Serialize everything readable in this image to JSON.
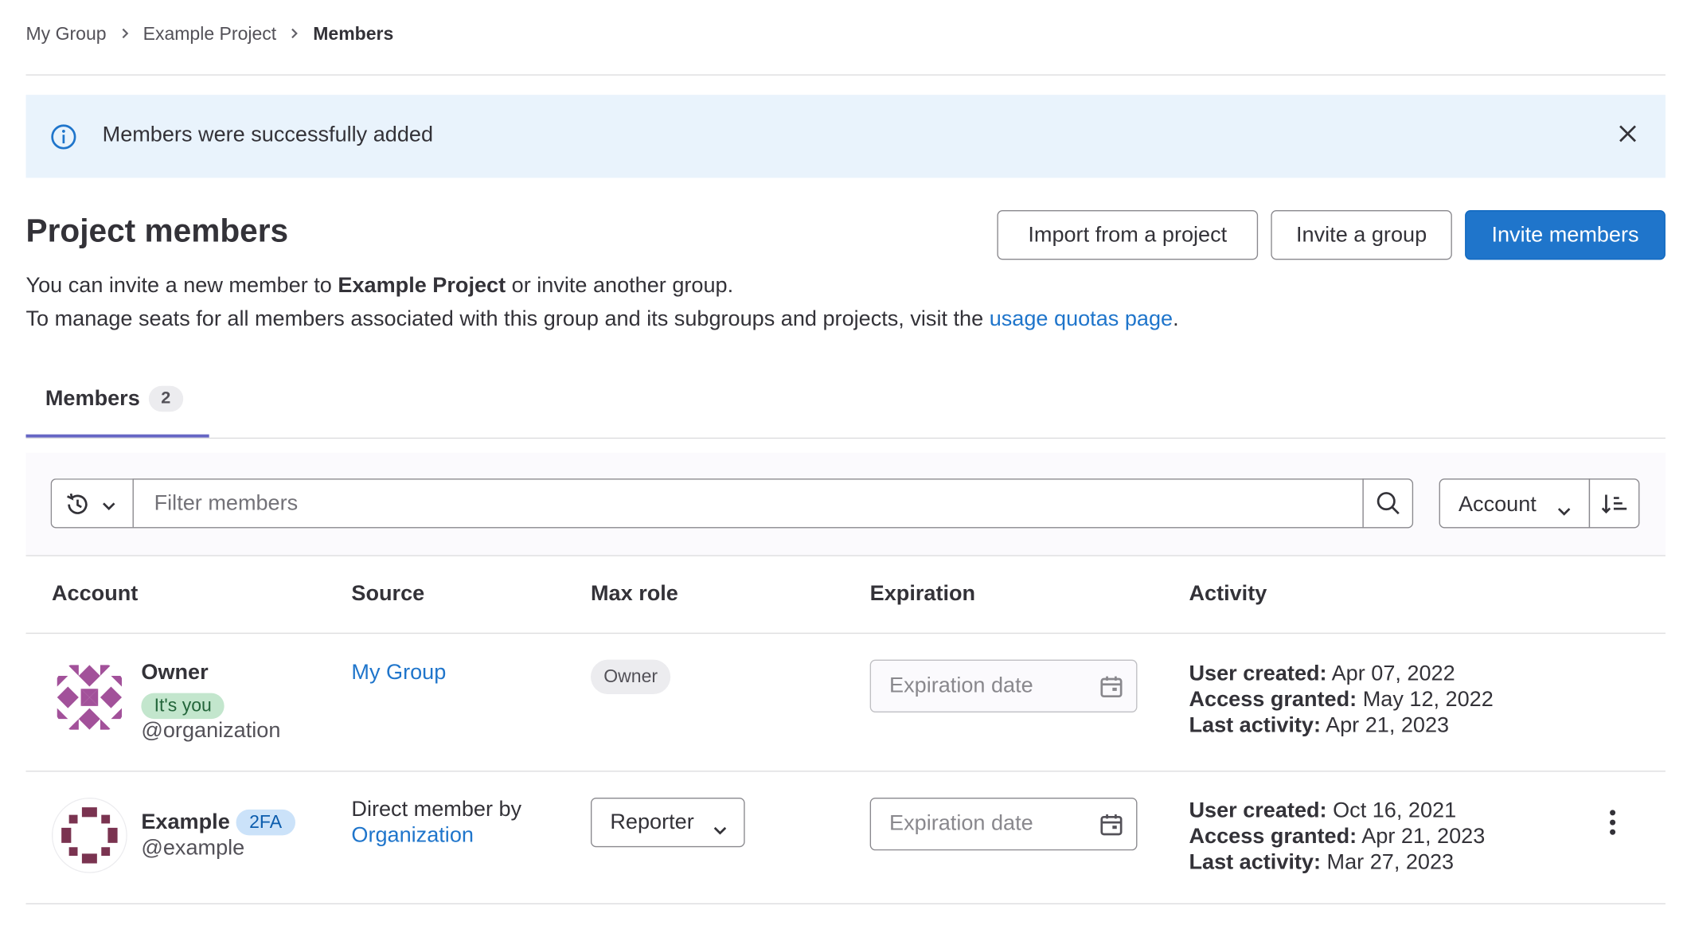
{
  "breadcrumb": {
    "items": [
      "My Group",
      "Example Project",
      "Members"
    ]
  },
  "alert": {
    "message": "Members were successfully added"
  },
  "header": {
    "title": "Project members",
    "buttons": {
      "import": "Import from a project",
      "invite_group": "Invite a group",
      "invite_members": "Invite members"
    },
    "description": {
      "line1_prefix": "You can invite a new member to ",
      "line1_project": "Example Project",
      "line1_suffix": " or invite another group.",
      "line2_prefix": "To manage seats for all members associated with this group and its subgroups and projects, visit the ",
      "line2_link": "usage quotas page",
      "line2_suffix": "."
    }
  },
  "tabs": [
    {
      "label": "Members",
      "count": "2",
      "active": true
    }
  ],
  "filter": {
    "placeholder": "Filter members",
    "sort_label": "Account"
  },
  "table": {
    "columns": [
      "Account",
      "Source",
      "Max role",
      "Expiration",
      "Activity"
    ],
    "rows": [
      {
        "name": "Owner",
        "badge": "It's you",
        "username": "@organization",
        "source_link": "My Group",
        "role": "Owner",
        "expiration_placeholder": "Expiration date",
        "activity": {
          "created_label": "User created:",
          "created": "Apr 07, 2022",
          "granted_label": "Access granted:",
          "granted": "May 12, 2022",
          "last_label": "Last activity:",
          "last": "Apr 21, 2023"
        }
      },
      {
        "name": "Example",
        "badge": "2FA",
        "username": "@example",
        "source_prefix": "Direct member by",
        "source_link": "Organization",
        "role": "Reporter",
        "expiration_placeholder": "Expiration date",
        "activity": {
          "created_label": "User created:",
          "created": "Oct 16, 2021",
          "granted_label": "Access granted:",
          "granted": "Apr 21, 2023",
          "last_label": "Last activity:",
          "last": "Mar 27, 2023"
        }
      }
    ]
  },
  "colors": {
    "primary": "#1f75cb",
    "alert_bg": "#e9f3fc",
    "tab_indicator": "#6666c4",
    "avatar_owner": "#a2519a",
    "avatar_example": "#7a3350"
  },
  "icons": [
    "info-icon",
    "close-icon",
    "history-icon",
    "chevron-down-icon",
    "search-icon",
    "sort-lowest-icon",
    "calendar-icon",
    "kebab-icon"
  ]
}
